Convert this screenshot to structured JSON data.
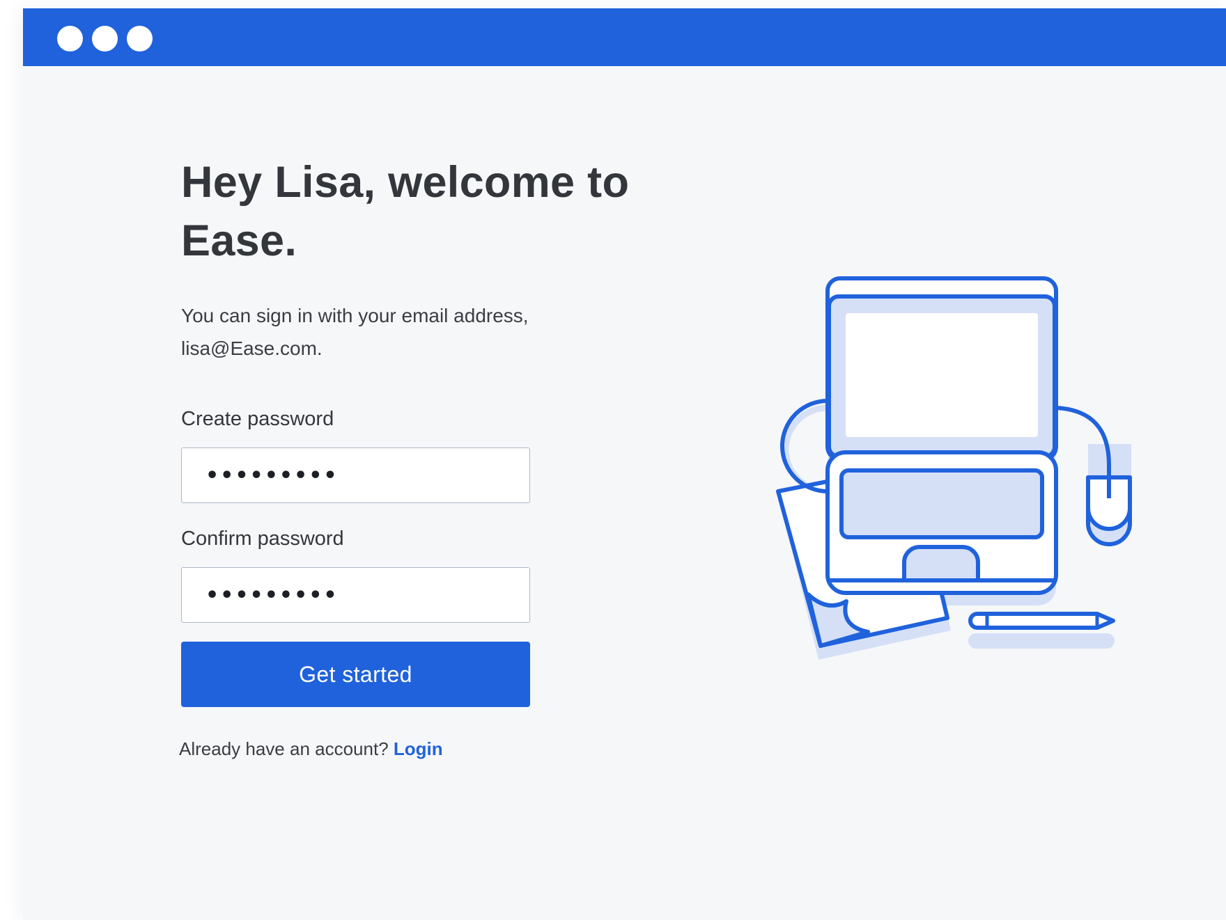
{
  "window": {
    "controls": [
      "window-dot",
      "window-dot",
      "window-dot"
    ]
  },
  "signup": {
    "title_line1": "Hey Lisa, welcome to",
    "title_line2": "Ease.",
    "intro_line1": "You can sign in with your email address,",
    "intro_line2": "lisa@Ease.com.",
    "create_password_label": "Create password",
    "create_password_value": "•••••••••",
    "confirm_password_label": "Confirm password",
    "confirm_password_value": "•••••••••",
    "submit_label": "Get started",
    "footer_text": "Already have an account?",
    "login_label": "Login"
  },
  "theme": {
    "accent": "#2062dc",
    "illustration_fill": "#d5e0f7",
    "background": "#f6f7f9"
  },
  "illustration": {
    "icon": "computer-desk-illustration"
  }
}
